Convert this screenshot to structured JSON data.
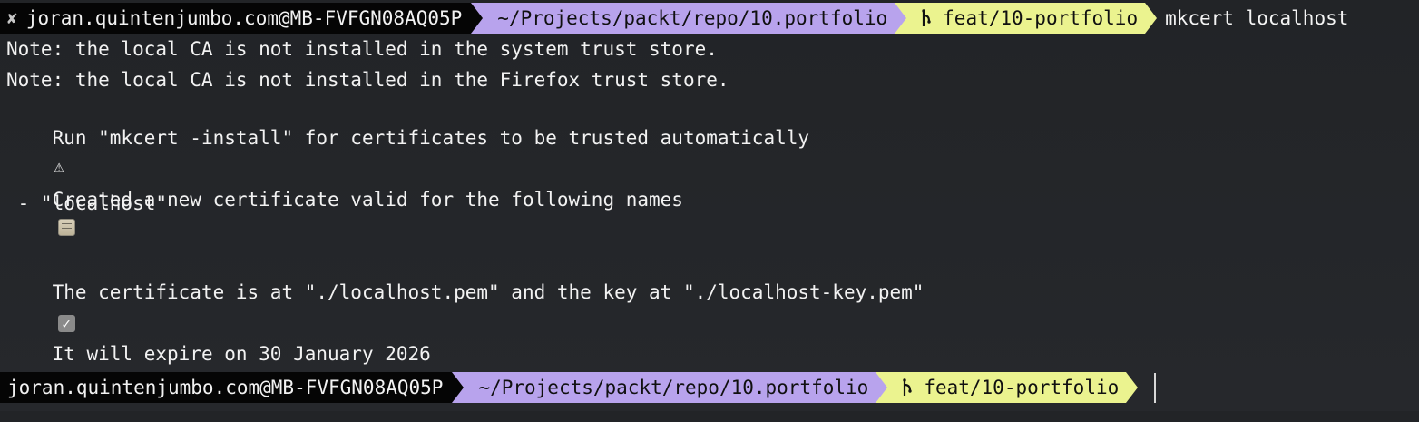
{
  "prompt": {
    "status_icon": "✘",
    "user_host": "joran.quintenjumbo.com@MB-FVFGN08AQ05P",
    "path": "~/Projects/packt/repo/10.portfolio",
    "branch_icon": "git-branch-icon",
    "branch": "feat/10-portfolio",
    "command": "mkcert localhost"
  },
  "output": {
    "line1": "Note: the local CA is not installed in the system trust store.",
    "line2": "Note: the local CA is not installed in the Firefox trust store.",
    "line3": "Run \"mkcert -install\" for certificates to be trusted automatically",
    "line3_icon": "⚠",
    "line4": "Created a new certificate valid for the following names",
    "line4_icon": "scroll-emoji-icon",
    "line5": " - \"localhost\"",
    "line6": "The certificate is at \"./localhost.pem\" and the key at \"./localhost-key.pem\"",
    "line6_icon": "✓",
    "line7": "It will expire on 30 January 2026",
    "line7_icon": "🗓"
  },
  "colors": {
    "background": "#242629",
    "user_segment": "#050505",
    "path_segment": "#b8a3ed",
    "branch_segment": "#ebf38f",
    "foreground": "#f2f2f2"
  }
}
